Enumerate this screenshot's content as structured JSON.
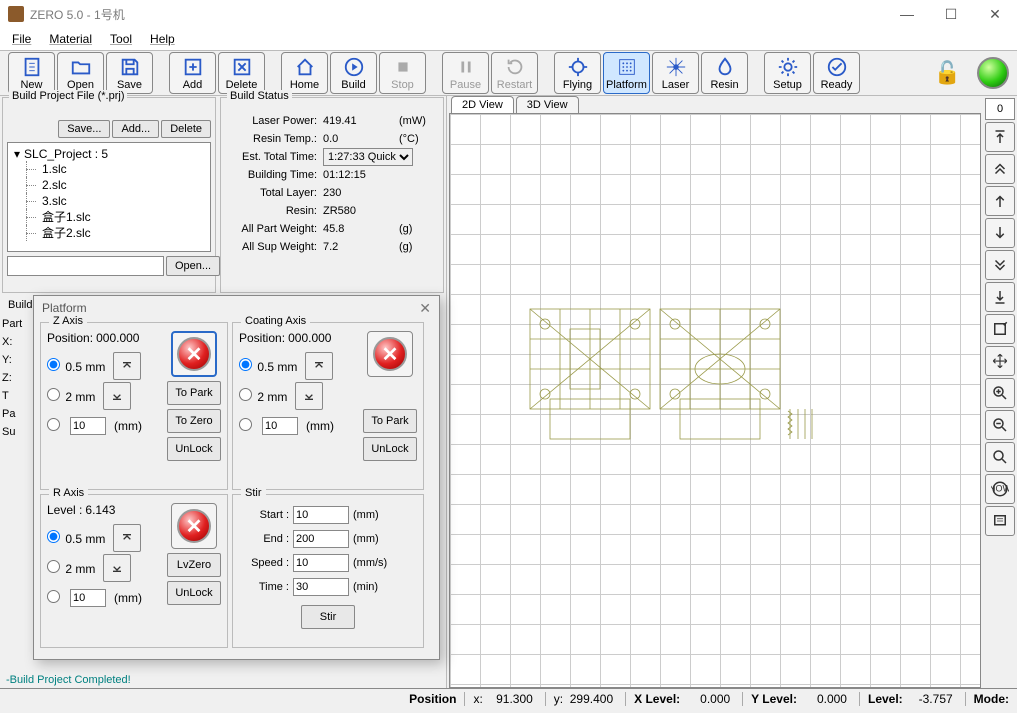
{
  "app": {
    "title": "ZERO 5.0 - 1号机"
  },
  "menu": {
    "file": "File",
    "material": "Material",
    "tool": "Tool",
    "help": "Help"
  },
  "toolbar": {
    "new": "New",
    "open": "Open",
    "save": "Save",
    "add": "Add",
    "delete": "Delete",
    "home": "Home",
    "build": "Build",
    "stop": "Stop",
    "pause": "Pause",
    "restart": "Restart",
    "flying": "Flying",
    "platform": "Platform",
    "laser": "Laser",
    "resin": "Resin",
    "setup": "Setup",
    "ready": "Ready"
  },
  "bpf": {
    "legend": "Build Project File (*.prj)",
    "save": "Save...",
    "add": "Add...",
    "delete": "Delete",
    "open": "Open...",
    "root": "SLC_Project : 5",
    "items": [
      "1.slc",
      "2.slc",
      "3.slc",
      "盒子1.slc",
      "盒子2.slc"
    ]
  },
  "bst": {
    "legend": "Build Status",
    "lp": "Laser Power:",
    "lp_v": "419.41",
    "lp_u": "(mW)",
    "rt": "Resin Temp.:",
    "rt_v": "0.0",
    "rt_u": "(°C)",
    "ett": "Est. Total Time:",
    "ett_v": "1:27:33 Quick",
    "bt": "Building Time:",
    "bt_v": "01:12:15",
    "tl": "Total Layer:",
    "tl_v": "230",
    "rs": "Resin:",
    "rs_v": "ZR580",
    "apw": "All Part Weight:",
    "apw_v": "45.8",
    "apw_u": "(g)",
    "asw": "All Sup Weight:",
    "asw_v": "7.2",
    "asw_u": "(g)"
  },
  "bp_label": "Build Parameters",
  "part": {
    "hdr": "Part",
    "x": "X:",
    "y": "Y:",
    "z": "Z:",
    "t": "T",
    "pa": "Pa",
    "su": "Su"
  },
  "status_msg": "-Build Project Completed!",
  "views": {
    "v2d": "2D View",
    "v3d": "3D View",
    "input": "0"
  },
  "dialog": {
    "title": "Platform",
    "z": {
      "legend": "Z Axis",
      "pos_l": "Position:",
      "pos_v": "000.000",
      "o1": "0.5 mm",
      "o2": "2 mm",
      "o3": "10",
      "ou": "(mm)",
      "topark": "To Park",
      "tozero": "To Zero",
      "unlock": "UnLock"
    },
    "c": {
      "legend": "Coating Axis",
      "pos_l": "Position:",
      "pos_v": "000.000",
      "o1": "0.5 mm",
      "o2": "2 mm",
      "o3": "10",
      "ou": "(mm)",
      "topark": "To Park",
      "unlock": "UnLock"
    },
    "r": {
      "legend": "R Axis",
      "lvl_l": "Level :",
      "lvl_v": "6.143",
      "o1": "0.5 mm",
      "o2": "2 mm",
      "o3": "10",
      "ou": "(mm)",
      "lvzero": "LvZero",
      "unlock": "UnLock"
    },
    "s": {
      "legend": "Stir",
      "start_l": "Start :",
      "start_v": "10",
      "start_u": "(mm)",
      "end_l": "End :",
      "end_v": "200",
      "end_u": "(mm)",
      "speed_l": "Speed :",
      "speed_v": "10",
      "speed_u": "(mm/s)",
      "time_l": "Time :",
      "time_v": "30",
      "time_u": "(min)",
      "stir": "Stir"
    }
  },
  "statusbar": {
    "pos": "Position",
    "x": "x:",
    "x_v": "91.300",
    "y": "y:",
    "y_v": "299.400",
    "xlvl": "X Level:",
    "xlvl_v": "0.000",
    "ylvl": "Y Level:",
    "ylvl_v": "0.000",
    "lvl": "Level:",
    "lvl_v": "-3.757",
    "mode": "Mode:"
  }
}
